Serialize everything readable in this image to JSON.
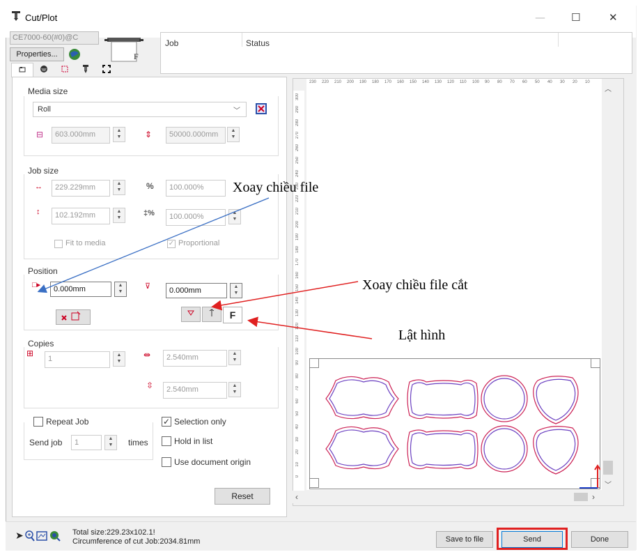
{
  "window": {
    "title": "Cut/Plot",
    "minimize_glyph": "—",
    "maximize_glyph": "☐",
    "close_glyph": "✕"
  },
  "top": {
    "device_combo": "CE7000-60(#0)@C",
    "properties_label": "Properties...",
    "preview_glyph": "F",
    "job_header": "Job",
    "status_header": "Status"
  },
  "tabs": [
    "general",
    "position",
    "crop",
    "cutter",
    "marks"
  ],
  "media_size": {
    "group_label": "Media size",
    "media_type": "Roll",
    "width": "603.000mm",
    "length": "50000.000mm"
  },
  "job_size": {
    "group_label": "Job size",
    "width": "229.229mm",
    "height": "102.192mm",
    "scale_x": "100.000%",
    "scale_y": "100.000%",
    "fit_to_media": "Fit to media",
    "proportional": "Proportional"
  },
  "position": {
    "group_label": "Position",
    "x": "0.000mm",
    "y": "0.000mm",
    "flip_glyph": "F"
  },
  "copies": {
    "group_label": "Copies",
    "count": "1",
    "spacing_x": "2.540mm",
    "spacing_y": "2.540mm"
  },
  "options": {
    "repeat_job": "Repeat Job",
    "send_job": "Send job",
    "send_job_count": "1",
    "times": "times",
    "selection_only": "Selection only",
    "hold_in_list": "Hold in list",
    "use_document_origin": "Use document origin",
    "reset": "Reset"
  },
  "ruler": {
    "top_ticks": [
      "230",
      "220",
      "210",
      "200",
      "190",
      "180",
      "170",
      "160",
      "150",
      "140",
      "130",
      "120",
      "110",
      "100",
      "90",
      "80",
      "70",
      "60",
      "50",
      "40",
      "30",
      "20",
      "10"
    ],
    "left_ticks": [
      "300",
      "290",
      "280",
      "270",
      "260",
      "250",
      "240",
      "230",
      "220",
      "210",
      "200",
      "190",
      "180",
      "170",
      "160",
      "150",
      "140",
      "130",
      "120",
      "110",
      "100",
      "90",
      "80",
      "70",
      "60",
      "50",
      "40",
      "30",
      "20",
      "10",
      "0"
    ]
  },
  "footer": {
    "total_size": "Total size:229.23x102.1!",
    "circumference": "Circumference of cut Job:2034.81mm",
    "save_to_file": "Save to file",
    "send": "Send",
    "done": "Done"
  },
  "annotations": {
    "rotate_file": "Xoay chiều file",
    "rotate_cut_file": "Xoay chiều file cắt",
    "flip_image": "Lật hình"
  },
  "colors": {
    "accent_red": "#e02020",
    "arrow_blue": "#3a6fc4",
    "shape_outline": "#cc2255"
  }
}
